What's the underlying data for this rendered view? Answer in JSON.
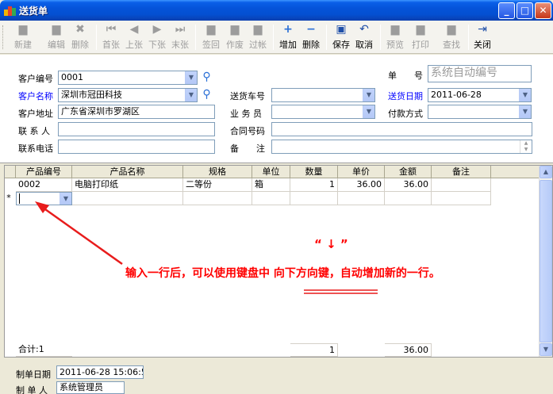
{
  "window": {
    "title": "送货单"
  },
  "toolbar": {
    "buttons": [
      {
        "label": "新建",
        "icon": "new-doc-icon",
        "enabled": false
      },
      {
        "label": "编辑",
        "icon": "edit-icon",
        "enabled": false
      },
      {
        "label": "删除",
        "icon": "delete-x-icon",
        "enabled": false
      },
      {
        "label": "首张",
        "icon": "first-record-icon",
        "enabled": false
      },
      {
        "label": "上张",
        "icon": "prev-record-icon",
        "enabled": false
      },
      {
        "label": "下张",
        "icon": "next-record-icon",
        "enabled": false
      },
      {
        "label": "末张",
        "icon": "last-record-icon",
        "enabled": false
      },
      {
        "label": "签回",
        "icon": "signback-icon",
        "enabled": false
      },
      {
        "label": "作废",
        "icon": "void-icon",
        "enabled": false
      },
      {
        "label": "过帐",
        "icon": "post-icon",
        "enabled": false
      },
      {
        "label": "增加",
        "icon": "plus-icon",
        "enabled": true
      },
      {
        "label": "删除",
        "icon": "minus-icon",
        "enabled": true
      },
      {
        "label": "保存",
        "icon": "save-icon",
        "enabled": true
      },
      {
        "label": "取消",
        "icon": "undo-icon",
        "enabled": true
      },
      {
        "label": "预览",
        "icon": "preview-icon",
        "enabled": false
      },
      {
        "label": "打印",
        "icon": "print-icon",
        "enabled": false
      },
      {
        "label": "查找",
        "icon": "find-icon",
        "enabled": false
      },
      {
        "label": "关闭",
        "icon": "exit-icon",
        "enabled": true
      }
    ]
  },
  "form": {
    "customer_code_label": "客户编号",
    "customer_code": "0001",
    "customer_name_label": "客户名称",
    "customer_name": "深圳市冠田科技",
    "customer_addr_label": "客户地址",
    "customer_addr": "广东省深圳市罗湖区",
    "contact_label": "联 系 人",
    "contact": "",
    "phone_label": "联系电话",
    "phone": "",
    "doc_no_label": "单　　号",
    "doc_no": "系统自动编号",
    "vehicle_label": "送货车号",
    "vehicle": "",
    "date_label": "送货日期",
    "date": "2011-06-28",
    "clerk_label": "业 务 员",
    "clerk": "",
    "payment_label": "付款方式",
    "payment": "",
    "contract_label": "合同号码",
    "contract": "",
    "remark_label": "备　　注",
    "remark": ""
  },
  "grid": {
    "columns": [
      "产品编号",
      "产品名称",
      "规格",
      "单位",
      "数量",
      "单价",
      "金额",
      "备注"
    ],
    "rows": [
      {
        "code": "0002",
        "name": "电脑打印纸",
        "spec": "二等份",
        "unit": "箱",
        "qty": "1",
        "price": "36.00",
        "amount": "36.00",
        "note": ""
      }
    ],
    "new_row_marker": "*",
    "total_label": "合计:1",
    "total_qty": "1",
    "total_amount": "36.00"
  },
  "annotation": {
    "key_quote": "“ ↓ ”",
    "text_prefix": "输入一行后，可以使用键盘中 ",
    "text_key": "向下方向键",
    "text_suffix": "，自动增加新的一行。",
    "color": "#ff0000"
  },
  "bottom": {
    "created_label": "制单日期",
    "created": "2011-06-28 15:06:55",
    "creator_label": "制 单 人",
    "creator": "系统管理员"
  }
}
